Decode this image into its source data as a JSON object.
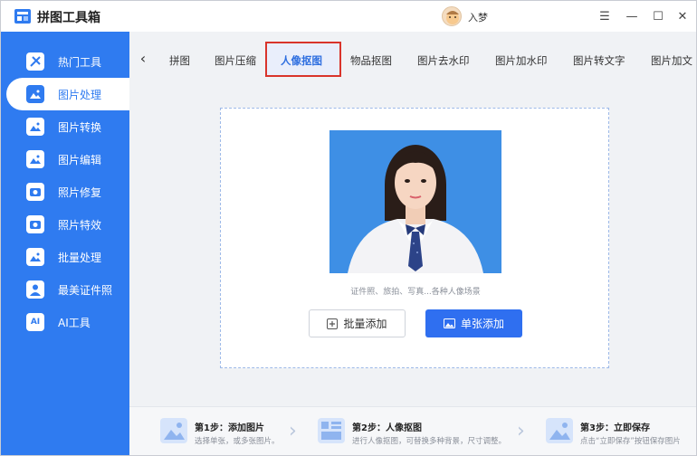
{
  "app": {
    "title": "拼图工具箱",
    "username": "入梦"
  },
  "window_controls": {
    "menu": "☰",
    "minimize": "—",
    "maximize": "☐",
    "close": "✕"
  },
  "sidebar": {
    "items": [
      {
        "label": "热门工具",
        "icon": "hot-tools-icon"
      },
      {
        "label": "图片处理",
        "icon": "image-process-icon",
        "active": true
      },
      {
        "label": "图片转换",
        "icon": "image-convert-icon"
      },
      {
        "label": "图片编辑",
        "icon": "image-edit-icon"
      },
      {
        "label": "照片修复",
        "icon": "photo-repair-icon"
      },
      {
        "label": "照片特效",
        "icon": "photo-effect-icon"
      },
      {
        "label": "批量处理",
        "icon": "batch-icon"
      },
      {
        "label": "最美证件照",
        "icon": "id-photo-icon"
      },
      {
        "label": "AI工具",
        "icon": "ai-icon",
        "icon_text": "AI"
      }
    ]
  },
  "tabs": {
    "back": "‹",
    "items": [
      {
        "label": "拼图"
      },
      {
        "label": "图片压缩"
      },
      {
        "label": "人像抠图",
        "active": true
      },
      {
        "label": "物品抠图"
      },
      {
        "label": "图片去水印"
      },
      {
        "label": "图片加水印"
      },
      {
        "label": "图片转文字"
      },
      {
        "label": "图片加文"
      }
    ]
  },
  "main": {
    "caption": "证件照、旅拍、写真...各种人像场景",
    "batch_button": "批量添加",
    "single_button": "单张添加"
  },
  "steps": [
    {
      "title": "第1步：添加图片",
      "desc": "选择单张，或多张图片。"
    },
    {
      "title": "第2步：人像抠图",
      "desc": "进行人像抠图，可替换多种背景，尺寸调整。"
    },
    {
      "title": "第3步：立即保存",
      "desc": "点击“立即保存”按钮保存图片"
    }
  ],
  "colors": {
    "accent": "#2f7bf0",
    "highlight_border": "#d9342b"
  }
}
